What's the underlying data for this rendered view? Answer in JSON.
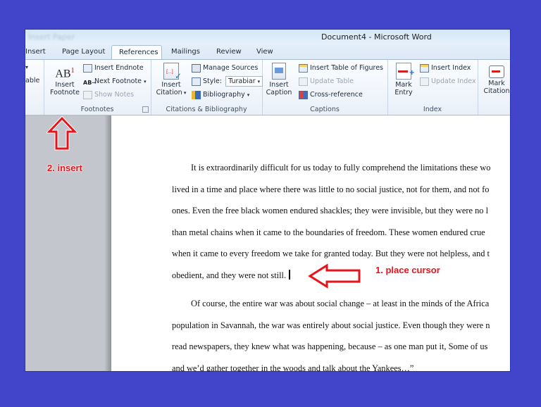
{
  "window": {
    "title": "Document4  -  Microsoft Word",
    "ghost_text": "Insert   Paper"
  },
  "tabs": [
    {
      "label": "Insert",
      "active": false
    },
    {
      "label": "Page Layout",
      "active": false
    },
    {
      "label": "References",
      "active": true
    },
    {
      "label": "Mailings",
      "active": false
    },
    {
      "label": "Review",
      "active": false
    },
    {
      "label": "View",
      "active": false
    }
  ],
  "ribbon": {
    "partial_left": {
      "label": "able"
    },
    "footnotes": {
      "group_label": "Footnotes",
      "insert_footnote": "Insert Footnote",
      "insert_endnote": "Insert Endnote",
      "next_footnote": "Next Footnote",
      "show_notes": "Show Notes",
      "icon_text": "AB",
      "icon_sup": "1"
    },
    "citations": {
      "group_label": "Citations & Bibliography",
      "insert_citation": "Insert Citation",
      "manage_sources": "Manage Sources",
      "style_label": "Style:",
      "style_value": "Turabiar",
      "bibliography": "Bibliography"
    },
    "captions": {
      "group_label": "Captions",
      "insert_caption": "Insert Caption",
      "insert_table_of_figures": "Insert Table of Figures",
      "update_table": "Update Table",
      "cross_reference": "Cross-reference"
    },
    "index": {
      "group_label": "Index",
      "mark_entry": "Mark Entry",
      "insert_index": "Insert Index",
      "update_index": "Update Index"
    },
    "toa": {
      "mark_citation": "Mark Citation"
    }
  },
  "document": {
    "lines": [
      "It is extraordinarily difficult for us today to fully comprehend the limitations these wo",
      "lived in a time and place where there was little to no social justice, not for them, and not fo",
      "ones. Even the free black women endured shackles;  they were invisible, but they were no l",
      "than metal chains when it came to the boundaries  of freedom.  These women endured crue",
      "when it came to every freedom we take for granted today. But they were not helpless, and t",
      "obedient, and they were not still.",
      "",
      "Of course, the entire war was about social change – at least in the minds of the Africa",
      "population in Savannah, the war was entirely about social justice. Even though they were n",
      "read newspapers, they knew what was happening, because – as one man put it, Some of us",
      "and we’d gather together in the woods and talk about the Yankees…”"
    ]
  },
  "annotations": {
    "step1": "1. place cursor",
    "step2": "2. insert",
    "color": "#e8141b"
  }
}
